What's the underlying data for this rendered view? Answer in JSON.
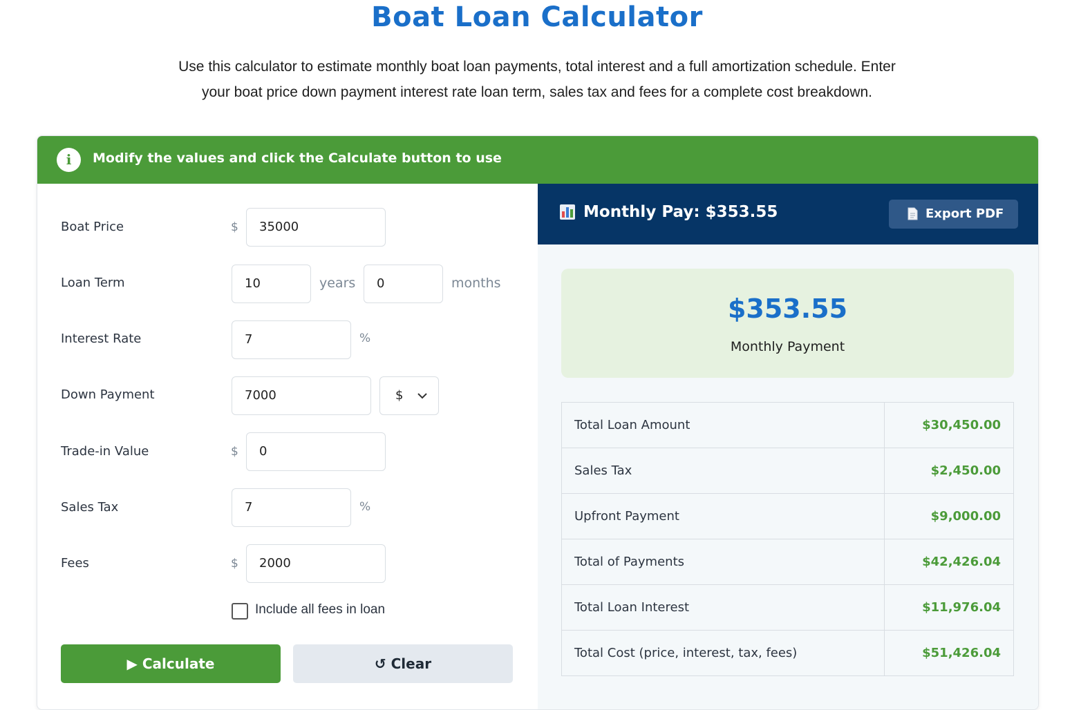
{
  "page": {
    "title": "Boat Loan Calculator",
    "intro_line1": "Use this calculator to estimate monthly boat loan payments, total interest and a full amortization schedule. Enter",
    "intro_line2": "your boat price down payment interest rate loan term, sales tax and fees for a complete cost breakdown."
  },
  "banner": {
    "icon": "info-icon",
    "icon_glyph": "i",
    "text": "Modify the values and click the Calculate button to use"
  },
  "form": {
    "boat_price": {
      "label": "Boat Price",
      "prefix": "$",
      "value": "35000"
    },
    "loan_term": {
      "label": "Loan Term",
      "years_value": "10",
      "years_unit": "years",
      "months_value": "0",
      "months_unit": "months"
    },
    "interest_rate": {
      "label": "Interest Rate",
      "value": "7",
      "suffix": "%"
    },
    "down_payment": {
      "label": "Down Payment",
      "value": "7000",
      "unit_selected": "$"
    },
    "trade_in": {
      "label": "Trade-in Value",
      "prefix": "$",
      "value": "0"
    },
    "sales_tax": {
      "label": "Sales Tax",
      "value": "7",
      "suffix": "%"
    },
    "fees": {
      "label": "Fees",
      "prefix": "$",
      "value": "2000"
    },
    "include_fees": {
      "label": "Include all fees in loan",
      "checked": false
    },
    "calculate_label": "▶ Calculate",
    "clear_label": "↺ Clear"
  },
  "results": {
    "header_icon": "bar-chart-icon",
    "header_text": "Monthly Pay: $353.55",
    "export_icon": "document-icon",
    "export_label": "Export PDF",
    "monthly_amount": "$353.55",
    "monthly_label": "Monthly Payment",
    "rows": [
      {
        "label": "Total Loan Amount",
        "value": "$30,450.00"
      },
      {
        "label": "Sales Tax",
        "value": "$2,450.00"
      },
      {
        "label": "Upfront Payment",
        "value": "$9,000.00"
      },
      {
        "label": "Total of Payments",
        "value": "$42,426.04"
      },
      {
        "label": "Total Loan Interest",
        "value": "$11,976.04"
      },
      {
        "label": "Total Cost (price, interest, tax, fees)",
        "value": "$51,426.04"
      }
    ]
  },
  "colors": {
    "title_blue": "#1a6fc9",
    "banner_green": "#4b9b39",
    "header_navy": "#063566",
    "result_bg": "#e6f2e0"
  }
}
